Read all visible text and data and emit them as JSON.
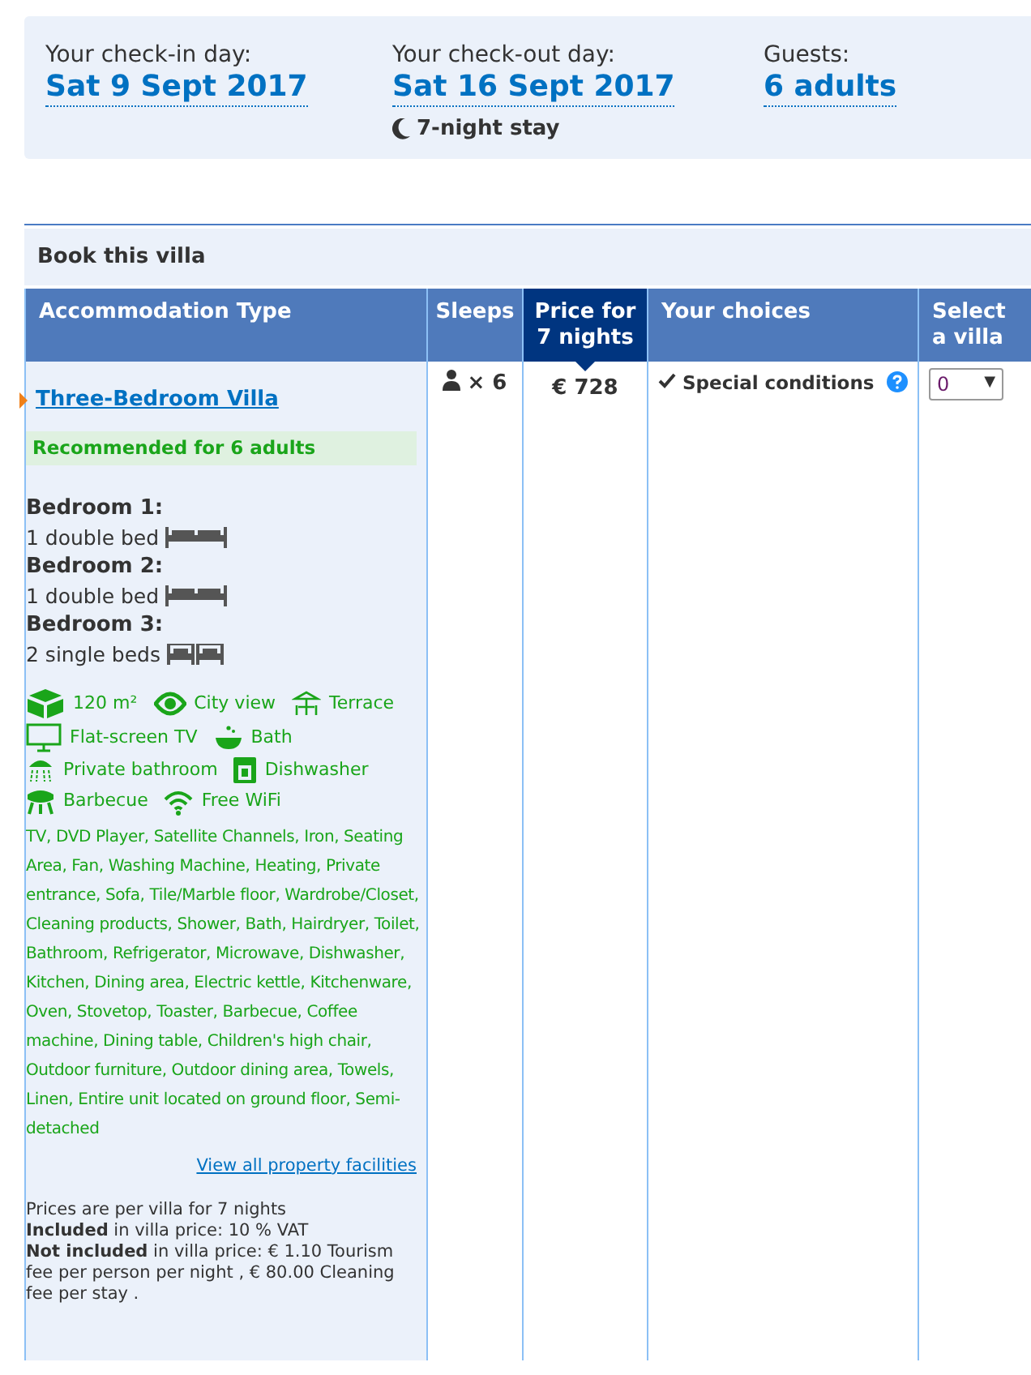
{
  "summary": {
    "checkin": {
      "label": "Your check-in day:",
      "value": "Sat 9 Sept 2017"
    },
    "checkout": {
      "label": "Your check-out day:",
      "value": "Sat 16 Sept 2017",
      "note": "7-night stay"
    },
    "guests": {
      "label": "Guests:",
      "value": "6 adults"
    }
  },
  "table": {
    "title": "Book this villa",
    "columns": [
      {
        "label": "Accommodation Type",
        "highlighted": false
      },
      {
        "label": "Sleeps",
        "highlighted": false
      },
      {
        "label": "Price for 7 nights",
        "highlighted": true
      },
      {
        "label": "Your choices",
        "highlighted": false
      },
      {
        "label": "Select a villa",
        "highlighted": false
      }
    ],
    "row": {
      "name": "Three-Bedroom Villa",
      "recommendation": "Recommended for 6 adults",
      "bedrooms": [
        {
          "title": "Bedroom 1:",
          "beds": "1 double bed",
          "kind": "double"
        },
        {
          "title": "Bedroom 2:",
          "beds": "1 double bed",
          "kind": "double"
        },
        {
          "title": "Bedroom 3:",
          "beds": "2 single beds",
          "kind": "twin"
        }
      ],
      "facilities": [
        [
          {
            "label": "120 m²",
            "kind": "size"
          },
          {
            "label": "City view",
            "kind": "view"
          },
          {
            "label": "Terrace",
            "kind": "terrace"
          }
        ],
        [
          {
            "label": "Flat-screen TV",
            "kind": "tv"
          },
          {
            "label": "Bath",
            "kind": "bath"
          }
        ],
        [
          {
            "label": "Private bathroom",
            "kind": "shower"
          },
          {
            "label": "Dishwasher",
            "kind": "dishwasher"
          }
        ],
        [
          {
            "label": "Barbecue",
            "kind": "barbecue"
          },
          {
            "label": "Free WiFi",
            "kind": "wifi"
          }
        ]
      ],
      "amenities": "TV, DVD Player, Satellite Channels, Iron, Seating Area, Fan, Washing Machine, Heating, Private entrance, Sofa, Tile/Marble floor, Wardrobe/Closet, Cleaning products, Shower, Bath, Hairdryer, Toilet, Bathroom, Refrigerator, Microwave, Dishwasher, Kitchen, Dining area, Electric kettle, Kitchenware, Oven, Stovetop, Toaster, Barbecue, Coffee machine, Dining table, Children's high chair, Outdoor furniture, Outdoor dining area, Towels, Linen, Entire unit located on ground floor, Semi-detached",
      "facilities_link": "View all property facilities",
      "notes": [
        "Prices are per villa for 7 nights",
        "**Included** in villa price: 10 % VAT",
        "**Not included** in villa price: € 1.10 Tourism fee per person per night , € 80.00 Cleaning fee per stay ."
      ],
      "sleeps": "× 6",
      "price": "€ 728",
      "choice": "Special conditions",
      "select_value": "0",
      "select_caret": "▼"
    }
  }
}
